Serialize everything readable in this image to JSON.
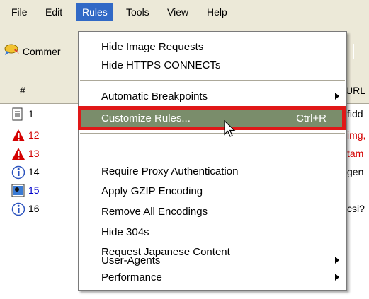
{
  "menubar": {
    "items": [
      {
        "label": "File"
      },
      {
        "label": "Edit"
      },
      {
        "label": "Rules"
      },
      {
        "label": "Tools"
      },
      {
        "label": "View"
      },
      {
        "label": "Help"
      }
    ]
  },
  "toolbar": {
    "comment_label": "Commer"
  },
  "columns": {
    "number": "#",
    "url": "URL"
  },
  "sessions": [
    {
      "num": "1",
      "icon": "document-icon",
      "url": "fidd",
      "color": "#000000"
    },
    {
      "num": "12",
      "icon": "warning-icon",
      "url": "img,",
      "color": "#d40000"
    },
    {
      "num": "13",
      "icon": "warning-icon",
      "url": "tam",
      "color": "#d40000"
    },
    {
      "num": "14",
      "icon": "info-icon",
      "url": "gen",
      "color": "#000000"
    },
    {
      "num": "15",
      "icon": "image-icon",
      "url": "",
      "color": "#0000cc"
    },
    {
      "num": "16",
      "icon": "info-icon",
      "url": "csi?",
      "color": "#000000"
    }
  ],
  "rules_menu": {
    "items": [
      {
        "label": "Hide Image Requests"
      },
      {
        "label": "Hide HTTPS CONNECTs"
      },
      {
        "label": "Automatic Breakpoints",
        "submenu": true
      },
      {
        "label": "Customize Rules...",
        "shortcut": "Ctrl+R",
        "highlighted": true
      },
      {
        "label": "Require Proxy Authentication"
      },
      {
        "label": "Apply GZIP Encoding"
      },
      {
        "label": "Remove All Encodings"
      },
      {
        "label": "Hide 304s"
      },
      {
        "label": "Request Japanese Content"
      },
      {
        "label": "User-Agents",
        "submenu": true
      },
      {
        "label": "Performance",
        "submenu": true
      }
    ]
  },
  "colors": {
    "menu_active": "#3169c6",
    "highlight": "#7a8d6b",
    "annotation_red": "#e01818"
  }
}
